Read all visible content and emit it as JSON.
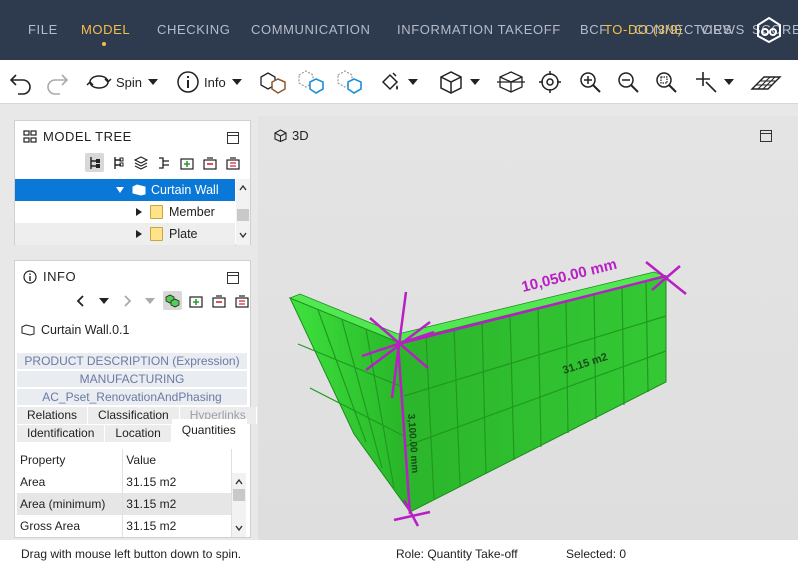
{
  "nav": {
    "tabs": [
      {
        "label": "FILE",
        "active": false
      },
      {
        "label": "MODEL",
        "active": true
      },
      {
        "label": "CHECKING",
        "active": false
      },
      {
        "label": "COMMUNICATION",
        "active": false
      },
      {
        "label": "INFORMATION TAKEOFF",
        "active": false
      },
      {
        "label": "BCF",
        "active": false
      },
      {
        "label": "CONNECTORS",
        "active": false
      },
      {
        "label": "VIEWS",
        "active": false
      },
      {
        "label": "SCORE",
        "active": false
      }
    ],
    "todo_label": "TO-DO (3/9)",
    "accent_color": "#f5c04a",
    "bar_color": "#2e3a4d"
  },
  "toolbar": {
    "spin_label": "Spin",
    "info_label": "Info"
  },
  "model_tree": {
    "title": "MODEL TREE",
    "items": [
      {
        "label": "Curtain Wall",
        "expanded": true,
        "selected": true
      },
      {
        "label": "Member",
        "expanded": false,
        "selected": false
      },
      {
        "label": "Plate",
        "expanded": false,
        "selected": false
      }
    ]
  },
  "info": {
    "title": "INFO",
    "object_name": "Curtain Wall.0.1",
    "psets": [
      "PRODUCT DESCRIPTION (Expression)",
      "MANUFACTURING",
      "AC_Pset_RenovationAndPhasing"
    ],
    "tabs_row1": [
      "Relations",
      "Classification",
      "Hyperlinks"
    ],
    "tabs_row2": [
      "Identification",
      "Location",
      "Quantities"
    ],
    "active_tab": "Quantities",
    "table": {
      "headers": [
        "Property",
        "Value"
      ],
      "rows": [
        [
          "Area",
          "31.15 m2"
        ],
        [
          "Area (minimum)",
          "31.15 m2"
        ],
        [
          "Gross Area",
          "31.15 m2"
        ]
      ]
    }
  },
  "viewport": {
    "view_label": "3D",
    "dimension_length": "10,050.00 mm",
    "dimension_height": "3,100.00 mm",
    "face_area": "31.15 m2",
    "wall_color": "#2fd12f",
    "dimension_color": "#b81fc4"
  },
  "status": {
    "hint": "Drag with mouse left button down to spin.",
    "role": "Role: Quantity Take-off",
    "selected": "Selected: 0"
  }
}
